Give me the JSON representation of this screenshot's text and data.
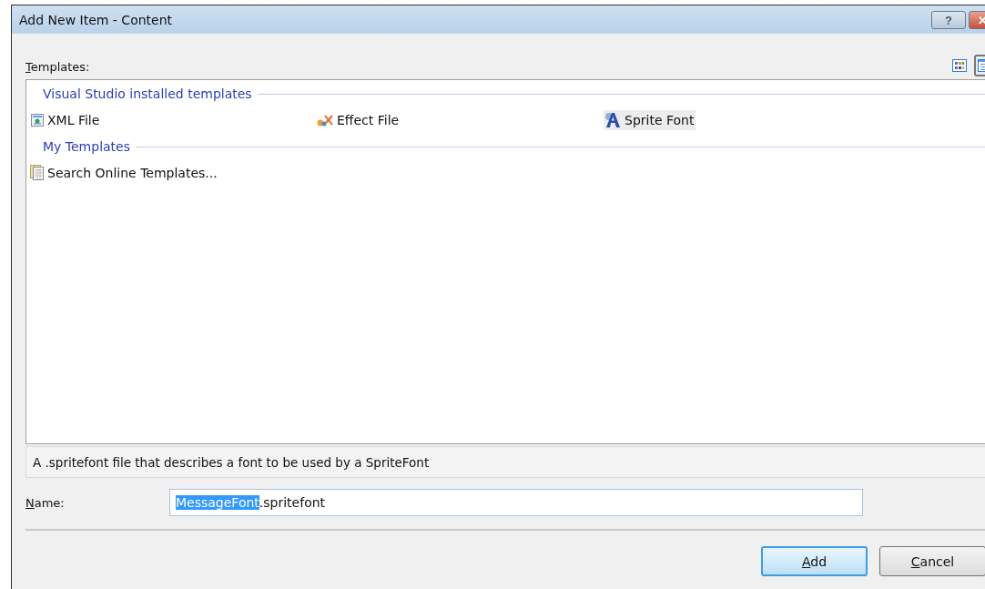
{
  "window": {
    "title": "Add New Item - Content",
    "buttons": [
      {
        "kind": "help",
        "label": "?"
      },
      {
        "kind": "close",
        "label": "✕"
      }
    ]
  },
  "templates_label": "Templates:",
  "view_buttons": [
    {
      "kind": "large-icons",
      "selected": false
    },
    {
      "kind": "small-icons",
      "selected": true
    }
  ],
  "groups": [
    {
      "title": "Visual Studio installed templates",
      "items": [
        {
          "label": "XML File",
          "kind": "xml",
          "selected": false
        },
        {
          "label": "Effect File",
          "kind": "effect",
          "selected": false
        },
        {
          "label": "Sprite Font",
          "kind": "font",
          "selected": true
        }
      ]
    },
    {
      "title": "My Templates",
      "items": [
        {
          "label": "Search Online Templates...",
          "kind": "online",
          "selected": false
        }
      ]
    }
  ],
  "description": "A .spritefont file that describes a font to be used by a SpriteFont",
  "name_label": "Name:",
  "name_field": {
    "selected_text": "MessageFont",
    "rest_text": ".spritefont"
  },
  "buttons": [
    {
      "label": "Add",
      "kind": "default"
    },
    {
      "label": "Cancel",
      "kind": "normal"
    }
  ]
}
